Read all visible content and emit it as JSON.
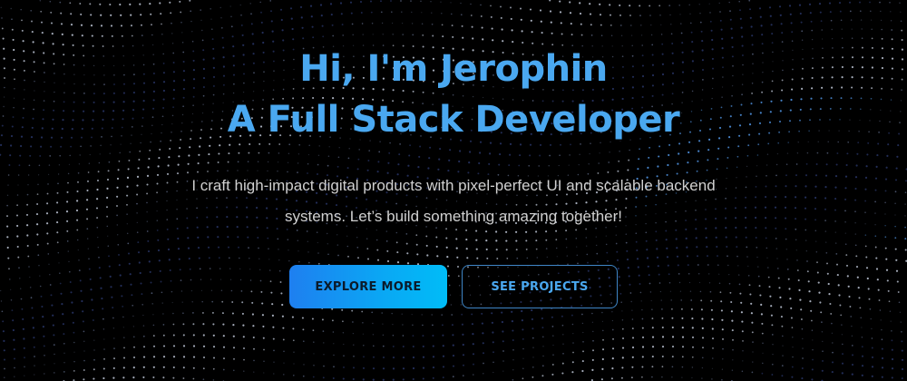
{
  "hero": {
    "headline_line1": "Hi, I'm Jerophin",
    "headline_line2": "A Full Stack Developer",
    "description_line1": "I craft high-impact digital products with pixel-perfect UI and scalable backend",
    "description_line2": "systems. Let’s build something amazing together!",
    "primary_button_label": "EXPLORE MORE",
    "secondary_button_label": "SEE PROJECTS"
  },
  "colors": {
    "background": "#000000",
    "accent": "#4aa8f0",
    "gradient_start": "#1e7ff0",
    "gradient_end": "#00bcf7",
    "body_text": "#d0d0d0"
  }
}
